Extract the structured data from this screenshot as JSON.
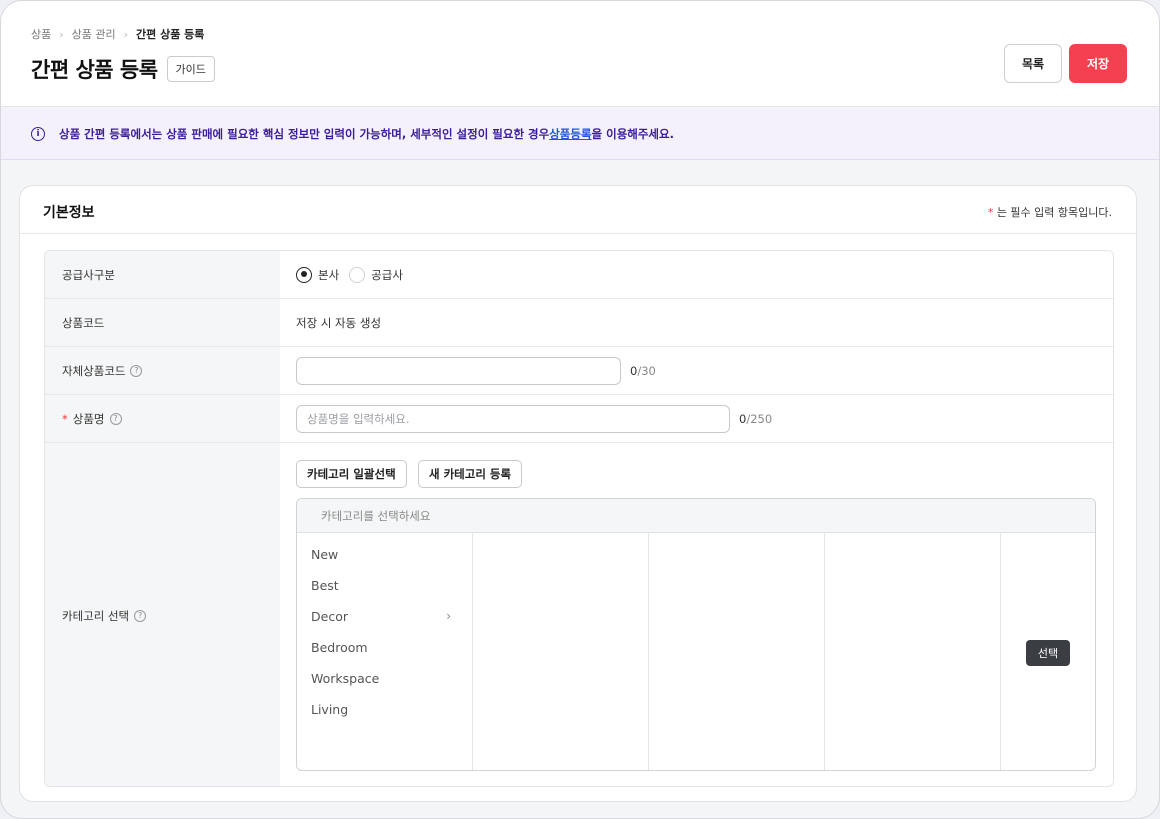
{
  "breadcrumb": [
    "상품",
    "상품 관리",
    "간편 상품 등록"
  ],
  "header": {
    "title": "간편 상품 등록",
    "guide_label": "가이드",
    "list_label": "목록",
    "save_label": "저장"
  },
  "notice": {
    "text_before": "상품 간편 등록에서는 상품 판매에 필요한 핵심 정보만 입력이 가능하며, 세부적인 설정이 필요한 경우 ",
    "link": "상품등록",
    "text_after": "을 이용해주세요."
  },
  "section": {
    "title": "기본정보",
    "required_mark": "*",
    "required_note": "는 필수 입력 항목입니다."
  },
  "fields": {
    "supplier_type": {
      "label": "공급사구분",
      "options": [
        "본사",
        "공급사"
      ],
      "selected": "본사"
    },
    "product_code": {
      "label": "상품코드",
      "value": "저장 시 자동 생성"
    },
    "own_code": {
      "label": "자체상품코드",
      "value": "",
      "count": "0",
      "max": "/30"
    },
    "product_name": {
      "required_mark": "*",
      "label": "상품명",
      "placeholder": "상품명을 입력하세요.",
      "count": "0",
      "max": "/250"
    },
    "category": {
      "label": "카테고리 선택",
      "bulk_select_label": "카테고리 일괄선택",
      "new_label": "새 카테고리 등록",
      "placeholder": "카테고리를 선택하세요",
      "items": [
        "New",
        "Best",
        "Decor",
        "Bedroom",
        "Workspace",
        "Living"
      ],
      "expandable_item": "Decor",
      "select_label": "선택"
    }
  }
}
